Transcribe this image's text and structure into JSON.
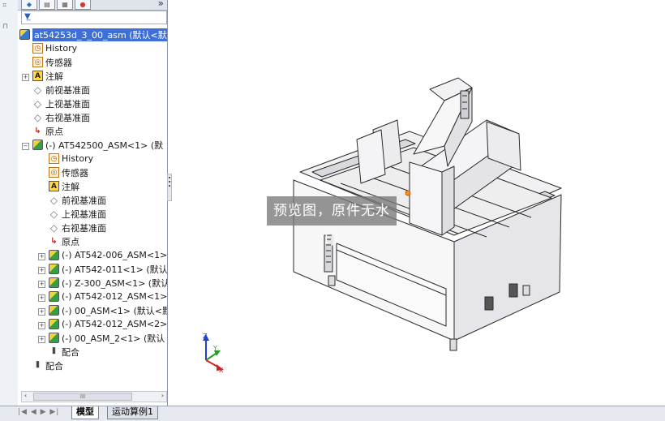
{
  "panel": {
    "more_glyph": "»",
    "filter_icon": "filter-icon"
  },
  "tree": {
    "root": "at54253d_3_00_asm  (默认<默",
    "items": [
      {
        "label": "History",
        "icon": "history-icon"
      },
      {
        "label": "传感器",
        "icon": "sensor-icon"
      },
      {
        "label": "注解",
        "icon": "annotation-icon"
      },
      {
        "label": "前视基准面",
        "icon": "plane-icon"
      },
      {
        "label": "上视基准面",
        "icon": "plane-icon"
      },
      {
        "label": "右视基准面",
        "icon": "plane-icon"
      },
      {
        "label": "原点",
        "icon": "origin-icon"
      },
      {
        "label": "(-) AT542500_ASM<1> (默",
        "icon": "assembly-icon"
      },
      {
        "label": "History",
        "icon": "history-icon"
      },
      {
        "label": "传感器",
        "icon": "sensor-icon"
      },
      {
        "label": "注解",
        "icon": "annotation-icon"
      },
      {
        "label": "前视基准面",
        "icon": "plane-icon"
      },
      {
        "label": "上视基准面",
        "icon": "plane-icon"
      },
      {
        "label": "右视基准面",
        "icon": "plane-icon"
      },
      {
        "label": "原点",
        "icon": "origin-icon"
      },
      {
        "label": "(-) AT542-006_ASM<1>",
        "icon": "assembly-icon"
      },
      {
        "label": "(-) AT542-011<1> (默认",
        "icon": "assembly-icon"
      },
      {
        "label": "(-) Z-300_ASM<1> (默认",
        "icon": "assembly-icon"
      },
      {
        "label": "(-) AT542-012_ASM<1>",
        "icon": "assembly-icon"
      },
      {
        "label": "(-) 00_ASM<1> (默认<默",
        "icon": "assembly-icon"
      },
      {
        "label": "(-) AT542-012_ASM<2>",
        "icon": "assembly-icon"
      },
      {
        "label": "(-) 00_ASM_2<1> (默认",
        "icon": "assembly-icon"
      },
      {
        "label": "配合",
        "icon": "mate-icon"
      },
      {
        "label": "配合",
        "icon": "mate-icon"
      }
    ]
  },
  "scrollbar": {
    "thumb_label": "III"
  },
  "bottom_tabs": [
    {
      "label": "模型",
      "active": true
    },
    {
      "label": "运动算例1",
      "active": false
    }
  ],
  "nav_buttons": "|◀ ◀ ▶ ▶|",
  "viewport": {
    "watermark": "预览图，原件无水印",
    "triad_axes": {
      "z": "Z",
      "y": "Y",
      "x": "X"
    }
  },
  "colors": {
    "selection": "#3d6fd6",
    "axis_x": "#d42020",
    "axis_y": "#2a9a2a",
    "axis_z": "#2040c8"
  }
}
